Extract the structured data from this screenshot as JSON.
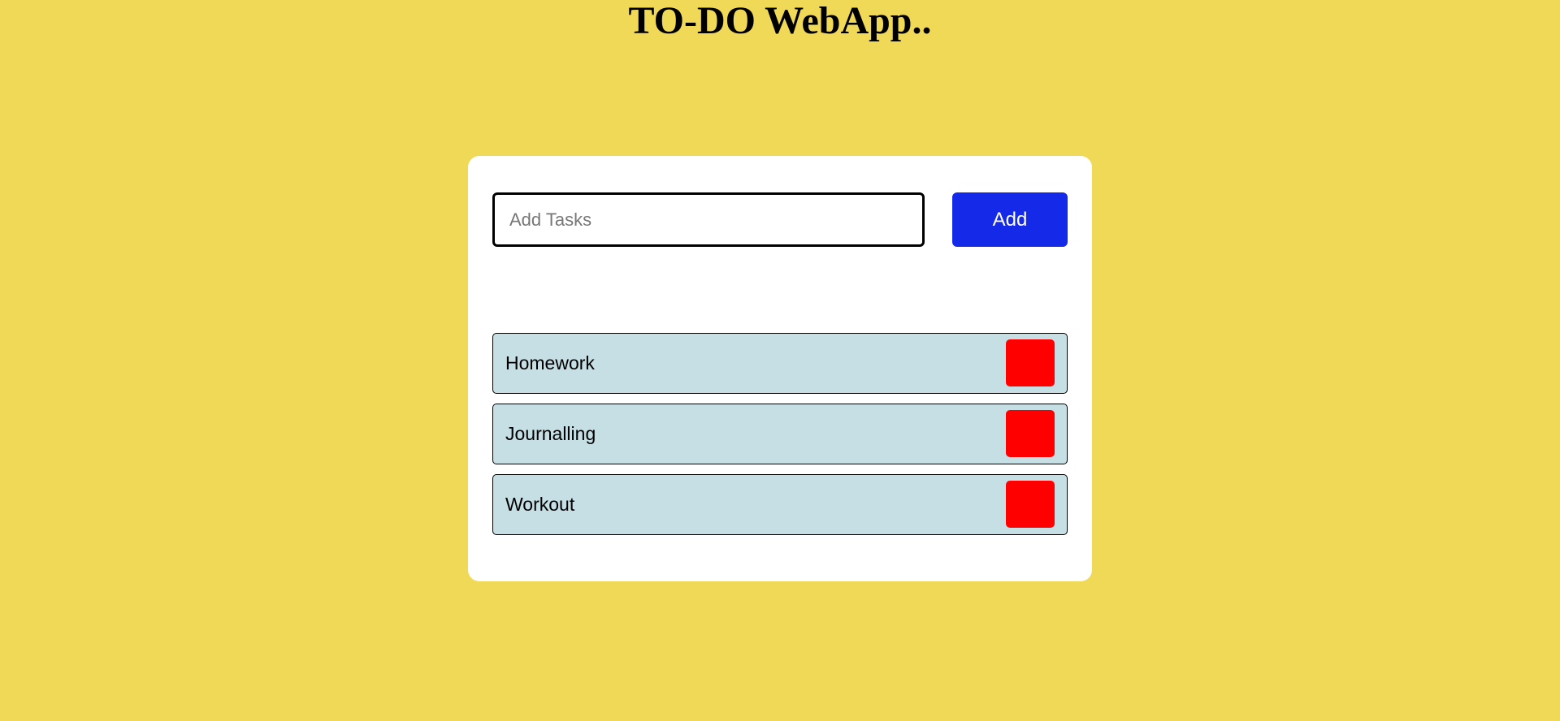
{
  "header": {
    "title": "TO-DO WebApp.."
  },
  "form": {
    "input_value": "",
    "input_placeholder": "Add Tasks",
    "add_label": "Add"
  },
  "tasks": [
    {
      "label": "Homework"
    },
    {
      "label": "Journalling"
    },
    {
      "label": "Workout"
    }
  ],
  "colors": {
    "page_background": "#f1d958",
    "card_background": "#ffffff",
    "add_button": "#1529e8",
    "task_background": "#c5dfe4",
    "delete_button": "#ff0000"
  }
}
